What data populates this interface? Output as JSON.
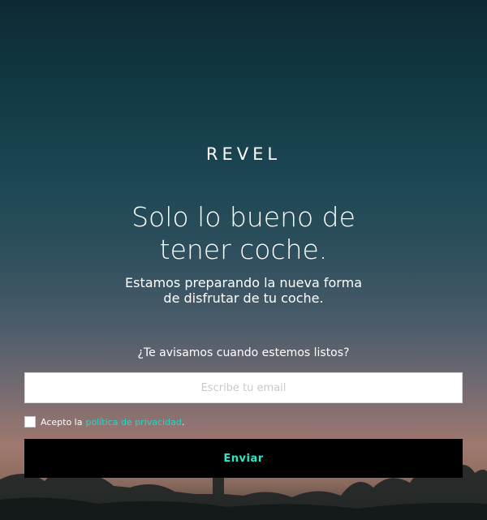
{
  "brand": {
    "logo_text": "REVEL"
  },
  "hero": {
    "headline_line1": "Solo lo bueno de",
    "headline_line2": "tener coche.",
    "subtitle_line1": "Estamos preparando la nueva forma",
    "subtitle_line2": "de disfrutar de tu coche."
  },
  "form": {
    "question": "¿Te avisamos cuando estemos listos?",
    "email_placeholder": "Escribe tu email",
    "email_value": "",
    "consent_prefix": "Acepto la",
    "consent_link": "política de privacidad",
    "consent_suffix": ".",
    "consent_checked": false,
    "submit_label": "Enviar"
  },
  "colors": {
    "accent": "#2ee6c8",
    "link": "#2ed3c7",
    "button_bg": "#000000"
  }
}
